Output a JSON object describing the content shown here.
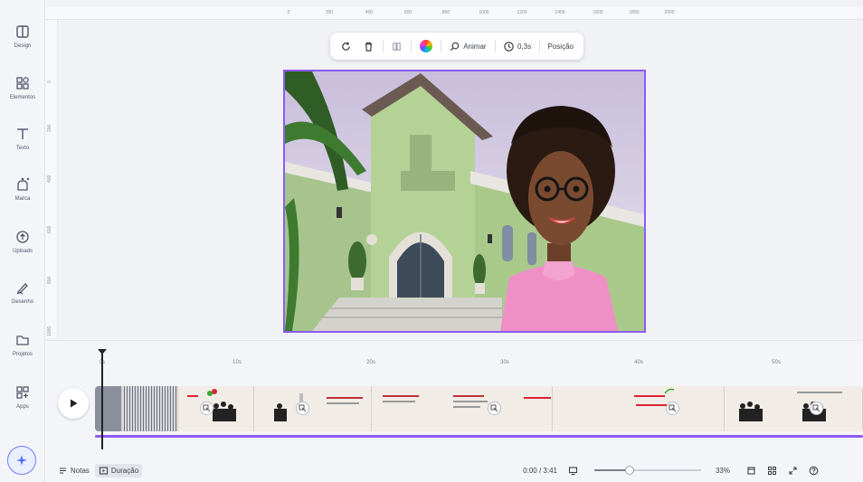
{
  "sidebar": {
    "items": [
      {
        "label": "Design",
        "icon": "layout-icon"
      },
      {
        "label": "Elementos",
        "icon": "shapes-icon"
      },
      {
        "label": "Texto",
        "icon": "text-icon"
      },
      {
        "label": "Marca",
        "icon": "brand-icon"
      },
      {
        "label": "Uploads",
        "icon": "upload-icon"
      },
      {
        "label": "Desenho",
        "icon": "draw-icon"
      },
      {
        "label": "Projetos",
        "icon": "folder-icon"
      },
      {
        "label": "Apps",
        "icon": "apps-icon"
      }
    ]
  },
  "ruler": {
    "top": [
      "0",
      "200",
      "400",
      "600",
      "800",
      "1000",
      "1200",
      "1400",
      "1600",
      "1800",
      "2000"
    ],
    "left": [
      "0",
      "200",
      "400",
      "600",
      "800",
      "1000"
    ]
  },
  "toolbar": {
    "animate_label": "Animar",
    "duration_label": "0,3s",
    "position_label": "Posição"
  },
  "timeline": {
    "marks": [
      "0s",
      "10s",
      "20s",
      "30s",
      "40s",
      "50s"
    ]
  },
  "bottombar": {
    "notes_label": "Notas",
    "duration_label": "Duração",
    "time_display": "0:00 / 3:41",
    "zoom_label": "33%",
    "zoom_value": 0.33
  },
  "colors": {
    "accent": "#8b5cf6",
    "building": "#a9c98b",
    "shirt": "#f08fc6"
  }
}
